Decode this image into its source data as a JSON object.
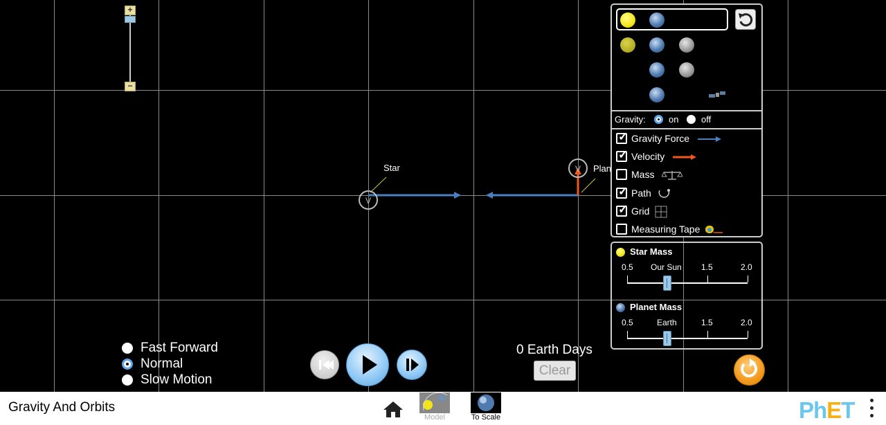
{
  "app": {
    "title": "Gravity And Orbits"
  },
  "bodies": {
    "star": {
      "label": "Star"
    },
    "planet": {
      "label": "Planet"
    }
  },
  "gravity": {
    "label": "Gravity:",
    "on_label": "on",
    "off_label": "off",
    "selected": "on"
  },
  "options": [
    {
      "key": "gravity_force",
      "label": "Gravity Force",
      "checked": true,
      "icon": "blue-arrow-icon"
    },
    {
      "key": "velocity",
      "label": "Velocity",
      "checked": true,
      "icon": "orange-arrow-icon"
    },
    {
      "key": "mass",
      "label": "Mass",
      "checked": false,
      "icon": "scale-icon"
    },
    {
      "key": "path",
      "label": "Path",
      "checked": true,
      "icon": "path-icon"
    },
    {
      "key": "grid",
      "label": "Grid",
      "checked": true,
      "icon": "grid-icon"
    },
    {
      "key": "measuring_tape",
      "label": "Measuring Tape",
      "checked": false,
      "icon": "tape-icon"
    }
  ],
  "star_mass": {
    "title": "Star Mass",
    "ticks": [
      "0.5",
      "Our Sun",
      "1.5",
      "2.0"
    ],
    "value": 1.0
  },
  "planet_mass": {
    "title": "Planet Mass",
    "ticks": [
      "0.5",
      "Earth",
      "1.5",
      "2.0"
    ],
    "value": 1.0
  },
  "speed": {
    "options": [
      "Fast Forward",
      "Normal",
      "Slow Motion"
    ],
    "selected": "Normal"
  },
  "timer": {
    "display": "0 Earth Days",
    "clear_label": "Clear"
  },
  "navbar": {
    "screens": [
      {
        "label": "Model",
        "selected": false
      },
      {
        "label": "To Scale",
        "selected": true
      }
    ],
    "brand": "PhET"
  },
  "colors": {
    "gravity_arrow": "#4a7fc1",
    "velocity_arrow": "#ef5a1a",
    "grid": "#8a8a8a",
    "radio_selected": "#60a8ee",
    "reset_all": "#f39a1e"
  }
}
